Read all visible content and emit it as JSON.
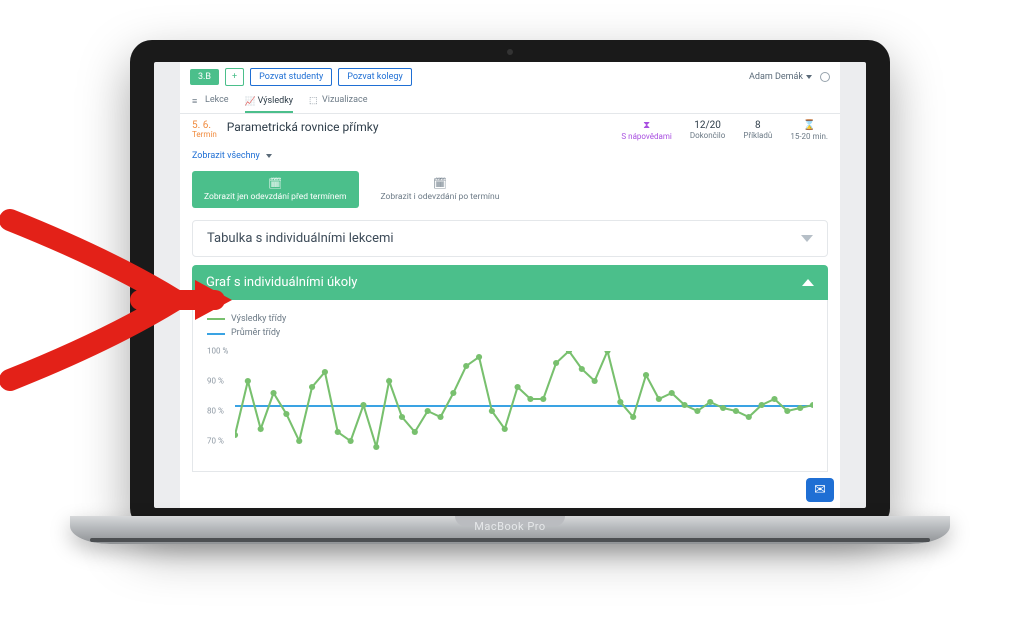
{
  "user_name": "Adam Demák",
  "class_badge": "3.B",
  "plus": "+",
  "btn_students": "Pozvat studenty",
  "btn_colleagues": "Pozvat kolegy",
  "tabs": {
    "lessons": "Lekce",
    "results": "Výsledky",
    "visual": "Vizualizace"
  },
  "lesson": {
    "day": "5. 6.",
    "sub": "Termín",
    "title": "Parametrická rovnice přímky"
  },
  "stats": {
    "hint": {
      "label": "S nápovědami"
    },
    "done": {
      "value": "12/20",
      "label": "Dokončilo"
    },
    "examples": {
      "value": "8",
      "label": "Příkladů"
    },
    "time": {
      "value": "",
      "label": "15-20 min."
    }
  },
  "show_all": "Zobrazit všechny",
  "action_before": "Zobrazit jen odevzdání před termínem",
  "action_after": "Zobrazit i odevzdání po termínu",
  "acc1": "Tabulka s individuálními lekcemi",
  "acc2": "Graf s individuálními úkoly",
  "legend": {
    "results": "Výsledky třídy",
    "avg": "Průměr třídy"
  },
  "device": "MacBook Pro",
  "chart_data": {
    "type": "line",
    "ylabel": "",
    "ylim": [
      60,
      100
    ],
    "y_ticks": [
      100,
      90,
      80,
      70
    ],
    "avg": 82,
    "series": [
      {
        "name": "Výsledky třídy",
        "values": [
          72,
          90,
          74,
          86,
          79,
          70,
          88,
          93,
          73,
          70,
          82,
          68,
          90,
          78,
          73,
          80,
          78,
          86,
          95,
          98,
          80,
          74,
          88,
          84,
          84,
          96,
          100,
          94,
          90,
          100,
          83,
          78,
          92,
          84,
          86,
          82,
          80,
          83,
          81,
          80,
          78,
          82,
          84,
          80,
          81,
          82
        ]
      }
    ]
  }
}
